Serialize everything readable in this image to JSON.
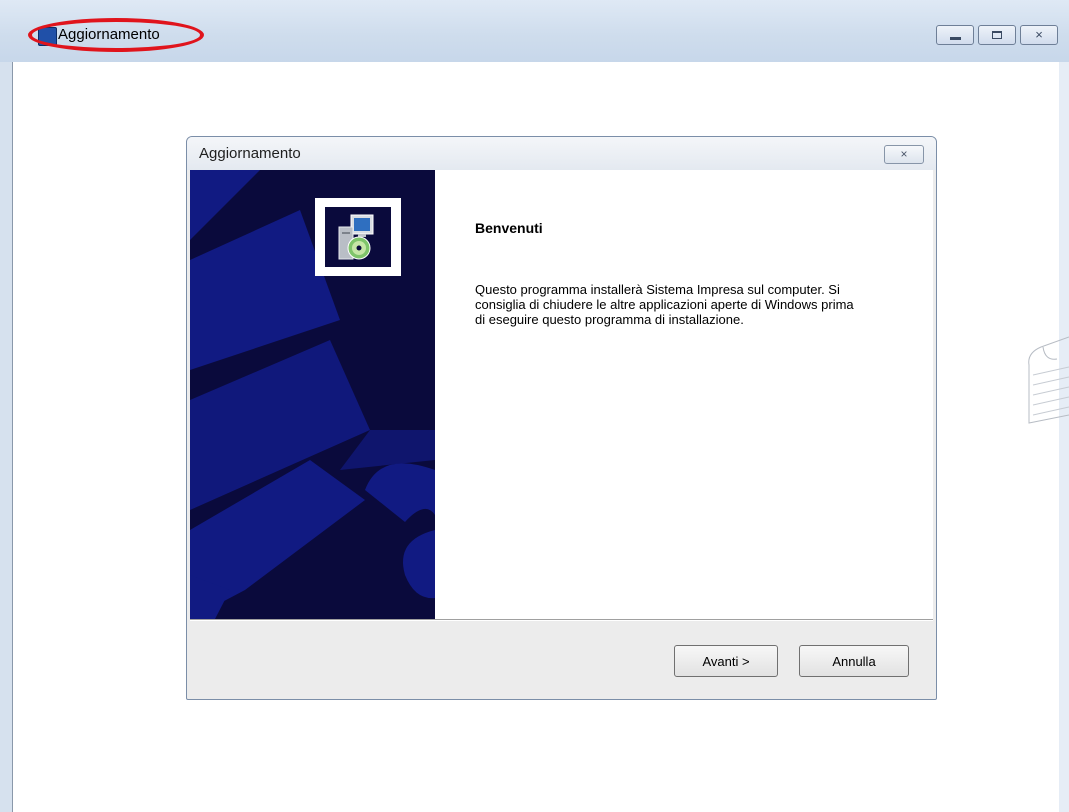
{
  "app_window": {
    "title": "Aggiornamento",
    "icon": "setup-app-icon",
    "controls": {
      "minimize": "minimize-icon",
      "maximize": "maximize-icon",
      "close": "×"
    }
  },
  "annotation": {
    "shape": "oval",
    "color": "#e0141c",
    "target": "app-window-title"
  },
  "dialog": {
    "title": "Aggiornamento",
    "close": "×",
    "icon": "installer-computer-cd-icon",
    "heading": "Benvenuti",
    "message": "Questo programma installerà Sistema Impresa sul computer.  Si consiglia di chiudere le altre applicazioni aperte di Windows prima di eseguire questo programma di installazione.",
    "buttons": {
      "next": "Avanti >",
      "cancel": "Annulla"
    }
  },
  "colors": {
    "side_panel": "#0a0a3c",
    "side_panel_shapes": "#111a82",
    "highlight": "#e0141c",
    "titlebar": "#cfdded"
  }
}
